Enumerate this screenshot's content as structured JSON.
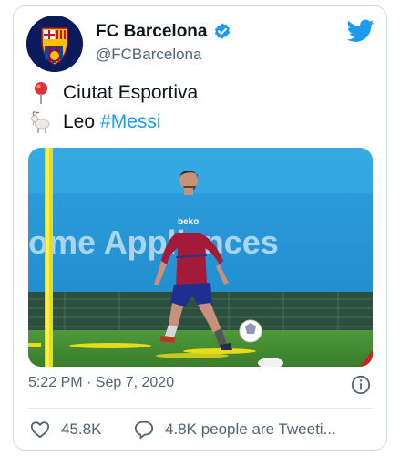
{
  "tweet": {
    "author_name": "FC Barcelona",
    "author_handle": "@FCBarcelona",
    "line1_text": "Ciutat Esportiva",
    "line2_text": "Leo",
    "line2_hashtag": "#Messi",
    "timestamp": "5:22 PM · Sep 7, 2020",
    "likes": "45.8K",
    "replies": "4.8K people are Tweeti...",
    "photo_banner_text": "ome Appliances",
    "shirt_sponsor": "beko",
    "avatar_crest_letters": "FCB"
  },
  "icons": {
    "verified": "verified-badge-icon",
    "bird": "twitter-bird-icon",
    "pin": "round-pushpin-icon",
    "goat": "goat-icon",
    "info": "info-icon",
    "heart": "heart-icon",
    "reply": "speech-bubble-icon"
  },
  "colors": {
    "twitter_blue": "#1d9bf0",
    "text_primary": "#0f1419",
    "text_secondary": "#536471"
  }
}
